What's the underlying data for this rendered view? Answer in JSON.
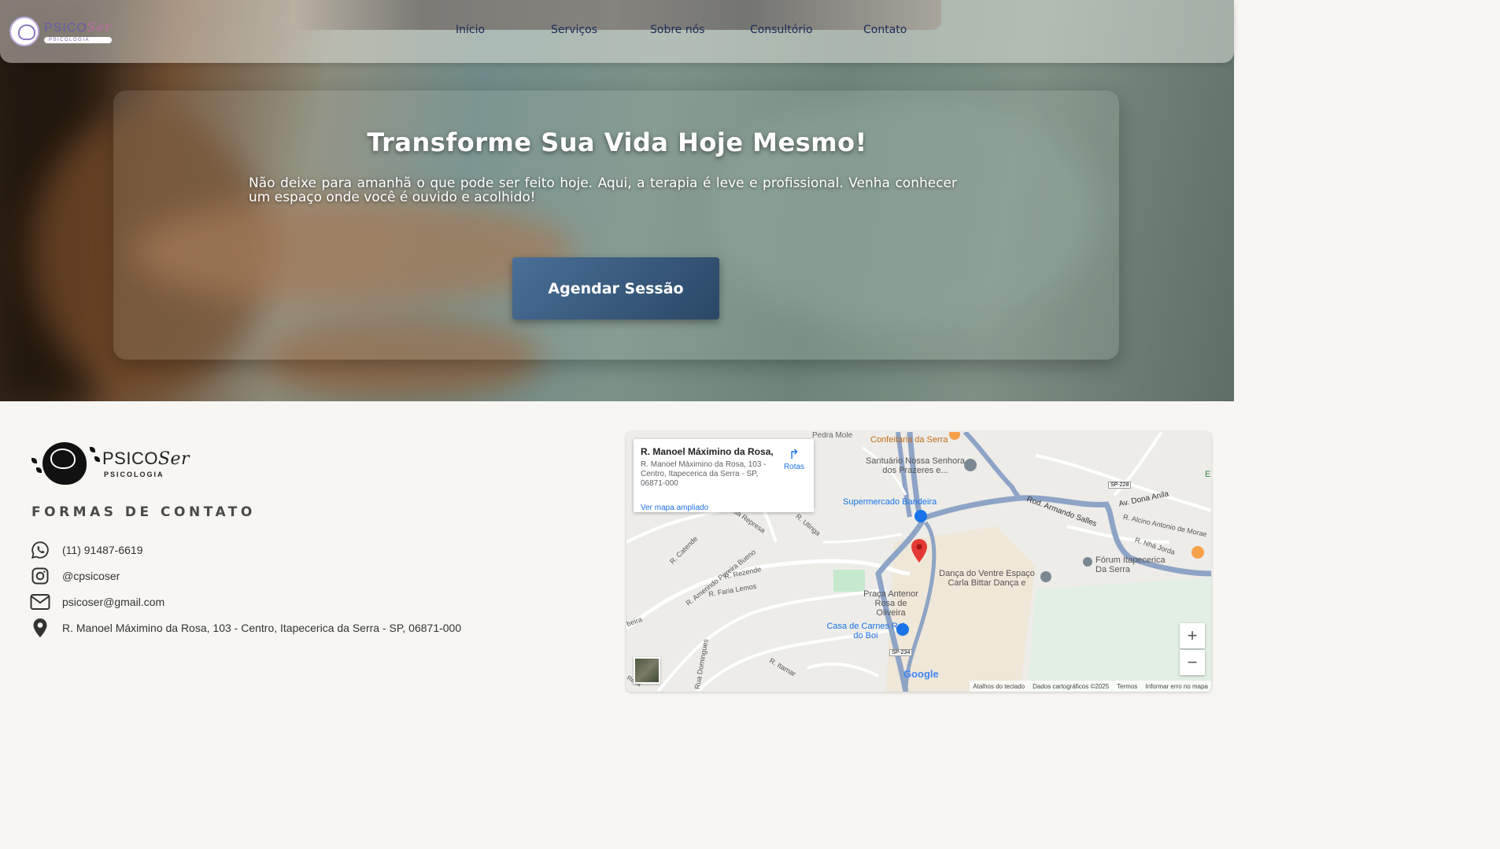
{
  "nav": {
    "logo_brand": "PSICO",
    "logo_brand_script": "Ser",
    "logo_sub": "PSICOLOGIA",
    "items": [
      {
        "label": "Início"
      },
      {
        "label": "Serviços"
      },
      {
        "label": "Sobre nós"
      },
      {
        "label": "Consultório"
      },
      {
        "label": "Contato"
      }
    ]
  },
  "hero": {
    "title": "Transforme Sua Vida Hoje Mesmo!",
    "text": "Não deixe para amanhã o que pode ser feito hoje. Aqui, a terapia é leve e profissional. Venha conhecer um espaço onde você é ouvido e acolhido!",
    "cta": "Agendar Sessão"
  },
  "footer": {
    "logo_brand": "PSICO",
    "logo_brand_script": "Ser",
    "logo_sub": "PSICOLOGIA",
    "heading": "FORMAS DE CONTATO",
    "contacts": [
      {
        "icon": "whatsapp-icon",
        "value": "(11) 91487-6619"
      },
      {
        "icon": "instagram-icon",
        "value": "@cpsicoser"
      },
      {
        "icon": "email-icon",
        "value": "psicoser@gmail.com"
      },
      {
        "icon": "location-pin-icon",
        "value": "R. Manoel Máximino da Rosa, 103 - Centro, Itapecerica da Serra - SP, 06871-000"
      }
    ]
  },
  "map": {
    "info_title": "R. Manoel Máximino da Rosa, ...",
    "info_address": "R. Manoel Máximino da Rosa, 103 - Centro, Itapecerica da Serra - SP, 06871-000",
    "info_link": "Ver mapa ampliado",
    "route_label": "Rotas",
    "labels": {
      "confeitaria": "Confeitaria da Serra",
      "santuario": "Santuário Nossa Senhora dos Prazeres e...",
      "supermercado": "Supermercado Bandeira",
      "armando": "Rod. Armando Salles",
      "dona_anila": "Av. Dona Anila",
      "alcino": "R. Alcino Antonio de Morae",
      "nha_jorda": "R. Nhá Jorda",
      "forum": "Fórum Itapecerica Da Serra",
      "danca": "Dança do Ventre Espaço Carla Bittar Dança e",
      "praca": "Praça Antenor Rosa de Oliveira",
      "casa_carnes": "Casa de Carnes Rei do Boi",
      "represa": "da Represa",
      "utinga": "R. Utinga",
      "catende": "R. Catende",
      "amerindo": "R. Amerindo Pereira Bueno",
      "rezende": "R. Rezende",
      "faria_lemos": "R. Faria Lemos",
      "itamar": "R. Itamar",
      "domingues": "Rua Domingues",
      "pedra_mole": "Pedra Mole",
      "sp228": "SP-228",
      "sp234": "SP-234",
      "beira": "beira",
      "repa": "Repa",
      "e": "E"
    },
    "zoom_in": "+",
    "zoom_out": "−",
    "google": "Google",
    "footer": [
      "Atalhos do teclado",
      "Dados cartográficos ©2025",
      "Termos",
      "Informar erro no mapa"
    ]
  }
}
